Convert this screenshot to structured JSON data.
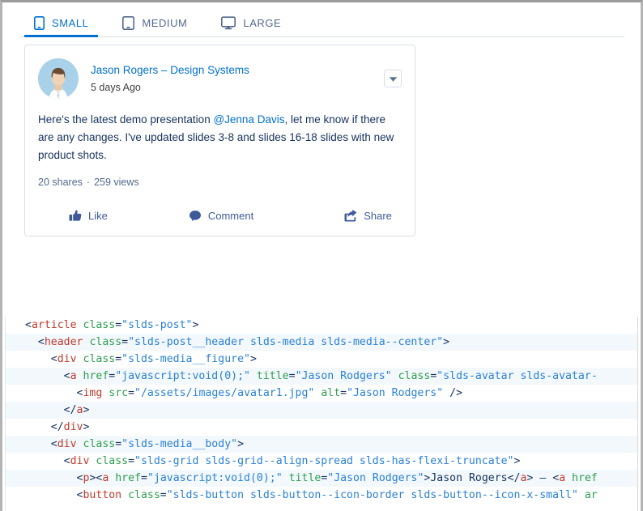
{
  "tabs": [
    {
      "label": "SMALL",
      "icon": "phone-icon",
      "active": true
    },
    {
      "label": "MEDIUM",
      "icon": "tablet-icon",
      "active": false
    },
    {
      "label": "LARGE",
      "icon": "desktop-icon",
      "active": false
    }
  ],
  "post": {
    "author": "Jason Rogers – Design Systems",
    "timestamp": "5 days Ago",
    "body_part1": "Here's the latest demo presentation ",
    "mention": "@Jenna Davis",
    "body_part2": ", let me know if there are any changes. I've updated slides 3-8 and slides 16-18 slides with new product shots.",
    "shares": "20 shares",
    "separator": "·",
    "views": "259 views",
    "menu_icon": "chevron-down-icon",
    "avatar_icon": "user-avatar",
    "actions": [
      {
        "label": "Like",
        "icon": "thumbs-up-icon"
      },
      {
        "label": "Comment",
        "icon": "comment-bubble-icon"
      },
      {
        "label": "Share",
        "icon": "share-icon"
      }
    ]
  },
  "code": {
    "lines": [
      {
        "indent": 0,
        "parts": [
          {
            "t": "punc",
            "v": "<"
          },
          {
            "t": "tag",
            "v": "article"
          },
          {
            "t": "text",
            "v": " "
          },
          {
            "t": "attr",
            "v": "class"
          },
          {
            "t": "punc",
            "v": "="
          },
          {
            "t": "val",
            "v": "\"slds-post\""
          },
          {
            "t": "punc",
            "v": ">"
          }
        ]
      },
      {
        "indent": 1,
        "parts": [
          {
            "t": "punc",
            "v": "<"
          },
          {
            "t": "tag",
            "v": "header"
          },
          {
            "t": "text",
            "v": " "
          },
          {
            "t": "attr",
            "v": "class"
          },
          {
            "t": "punc",
            "v": "="
          },
          {
            "t": "val",
            "v": "\"slds-post__header slds-media slds-media--center\""
          },
          {
            "t": "punc",
            "v": ">"
          }
        ]
      },
      {
        "indent": 2,
        "parts": [
          {
            "t": "punc",
            "v": "<"
          },
          {
            "t": "tag",
            "v": "div"
          },
          {
            "t": "text",
            "v": " "
          },
          {
            "t": "attr",
            "v": "class"
          },
          {
            "t": "punc",
            "v": "="
          },
          {
            "t": "val",
            "v": "\"slds-media__figure\""
          },
          {
            "t": "punc",
            "v": ">"
          }
        ]
      },
      {
        "indent": 3,
        "parts": [
          {
            "t": "punc",
            "v": "<"
          },
          {
            "t": "tag",
            "v": "a"
          },
          {
            "t": "text",
            "v": " "
          },
          {
            "t": "attr",
            "v": "href"
          },
          {
            "t": "punc",
            "v": "="
          },
          {
            "t": "val",
            "v": "\"javascript:void(0);\""
          },
          {
            "t": "text",
            "v": " "
          },
          {
            "t": "attr",
            "v": "title"
          },
          {
            "t": "punc",
            "v": "="
          },
          {
            "t": "val",
            "v": "\"Jason Rodgers\""
          },
          {
            "t": "text",
            "v": " "
          },
          {
            "t": "attr",
            "v": "class"
          },
          {
            "t": "punc",
            "v": "="
          },
          {
            "t": "val",
            "v": "\"slds-avatar slds-avatar-"
          }
        ]
      },
      {
        "indent": 4,
        "parts": [
          {
            "t": "punc",
            "v": "<"
          },
          {
            "t": "tag",
            "v": "img"
          },
          {
            "t": "text",
            "v": " "
          },
          {
            "t": "attr",
            "v": "src"
          },
          {
            "t": "punc",
            "v": "="
          },
          {
            "t": "val",
            "v": "\"/assets/images/avatar1.jpg\""
          },
          {
            "t": "text",
            "v": " "
          },
          {
            "t": "attr",
            "v": "alt"
          },
          {
            "t": "punc",
            "v": "="
          },
          {
            "t": "val",
            "v": "\"Jason Rodgers\""
          },
          {
            "t": "punc",
            "v": " />"
          }
        ]
      },
      {
        "indent": 3,
        "parts": [
          {
            "t": "punc",
            "v": "</"
          },
          {
            "t": "tag",
            "v": "a"
          },
          {
            "t": "punc",
            "v": ">"
          }
        ]
      },
      {
        "indent": 2,
        "parts": [
          {
            "t": "punc",
            "v": "</"
          },
          {
            "t": "tag",
            "v": "div"
          },
          {
            "t": "punc",
            "v": ">"
          }
        ]
      },
      {
        "indent": 2,
        "parts": [
          {
            "t": "punc",
            "v": "<"
          },
          {
            "t": "tag",
            "v": "div"
          },
          {
            "t": "text",
            "v": " "
          },
          {
            "t": "attr",
            "v": "class"
          },
          {
            "t": "punc",
            "v": "="
          },
          {
            "t": "val",
            "v": "\"slds-media__body\""
          },
          {
            "t": "punc",
            "v": ">"
          }
        ]
      },
      {
        "indent": 3,
        "parts": [
          {
            "t": "punc",
            "v": "<"
          },
          {
            "t": "tag",
            "v": "div"
          },
          {
            "t": "text",
            "v": " "
          },
          {
            "t": "attr",
            "v": "class"
          },
          {
            "t": "punc",
            "v": "="
          },
          {
            "t": "val",
            "v": "\"slds-grid slds-grid--align-spread slds-has-flexi-truncate\""
          },
          {
            "t": "punc",
            "v": ">"
          }
        ]
      },
      {
        "indent": 4,
        "parts": [
          {
            "t": "punc",
            "v": "<"
          },
          {
            "t": "tag",
            "v": "p"
          },
          {
            "t": "punc",
            "v": "><"
          },
          {
            "t": "tag",
            "v": "a"
          },
          {
            "t": "text",
            "v": " "
          },
          {
            "t": "attr",
            "v": "href"
          },
          {
            "t": "punc",
            "v": "="
          },
          {
            "t": "val",
            "v": "\"javascript:void(0);\""
          },
          {
            "t": "text",
            "v": " "
          },
          {
            "t": "attr",
            "v": "title"
          },
          {
            "t": "punc",
            "v": "="
          },
          {
            "t": "val",
            "v": "\"Jason Rodgers\""
          },
          {
            "t": "punc",
            "v": ">"
          },
          {
            "t": "text",
            "v": "Jason Rogers"
          },
          {
            "t": "punc",
            "v": "</"
          },
          {
            "t": "tag",
            "v": "a"
          },
          {
            "t": "punc",
            "v": ">"
          },
          {
            "t": "text",
            "v": " – "
          },
          {
            "t": "punc",
            "v": "<"
          },
          {
            "t": "tag",
            "v": "a"
          },
          {
            "t": "text",
            "v": " "
          },
          {
            "t": "attr",
            "v": "href"
          }
        ]
      },
      {
        "indent": 4,
        "parts": [
          {
            "t": "punc",
            "v": "<"
          },
          {
            "t": "tag",
            "v": "button"
          },
          {
            "t": "text",
            "v": " "
          },
          {
            "t": "attr",
            "v": "class"
          },
          {
            "t": "punc",
            "v": "="
          },
          {
            "t": "val",
            "v": "\"slds-button slds-button--icon-border slds-button--icon-x-small\""
          },
          {
            "t": "text",
            "v": " "
          },
          {
            "t": "attr",
            "v": "ar"
          }
        ]
      }
    ]
  }
}
